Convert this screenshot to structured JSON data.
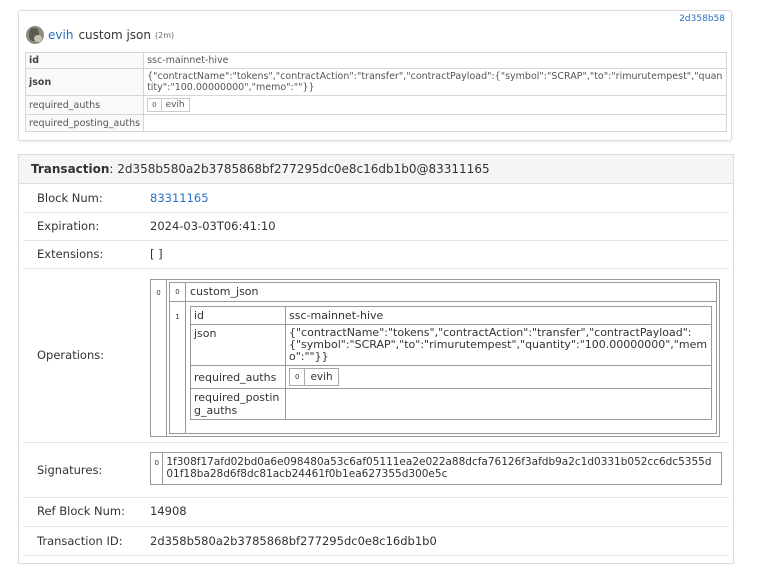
{
  "op_card": {
    "hash_link": "2d358b58",
    "user": "evih",
    "op_type": "custom json",
    "age": "(2m)",
    "fields": {
      "id_label": "id",
      "id_value": "ssc-mainnet-hive",
      "json_label": "json",
      "json_value": "{\"contractName\":\"tokens\",\"contractAction\":\"transfer\",\"contractPayload\":{\"symbol\":\"SCRAP\",\"to\":\"rimurutempest\",\"quantity\":\"100.00000000\",\"memo\":\"\"}}",
      "required_auths_label": "required_auths",
      "required_auths_index": "0",
      "required_auths_value": "evih",
      "required_posting_auths_label": "required_posting_auths"
    }
  },
  "transaction": {
    "header_label": "Transaction",
    "header_value": ": 2d358b580a2b3785868bf277295dc0e8c16db1b0@83311165",
    "block_num_label": "Block Num:",
    "block_num_value": "83311165",
    "expiration_label": "Expiration:",
    "expiration_value": "2024-03-03T06:41:10",
    "extensions_label": "Extensions:",
    "extensions_value": "[ ]",
    "operations_label": "Operations:",
    "operations": {
      "outer_index": "0",
      "inner_index": "0",
      "op_name": "custom_json",
      "param_index": "1",
      "id_label": "id",
      "id_value": "ssc-mainnet-hive",
      "json_label": "json",
      "json_value": "{\"contractName\":\"tokens\",\"contractAction\":\"transfer\",\"contractPayload\":{\"symbol\":\"SCRAP\",\"to\":\"rimurutempest\",\"quantity\":\"100.00000000\",\"memo\":\"\"}}",
      "required_auths_label": "required_auths",
      "required_auths_index": "0",
      "required_auths_value": "evih",
      "required_posting_auths_label": "required_posting_auths"
    },
    "signatures_label": "Signatures:",
    "signature_index": "0",
    "signature_value": "1f308f17afd02bd0a6e098480a53c6af05111ea2e022a88dcfa76126f3afdb9a2c1d0331b052cc6dc5355d01f18ba28d6f8dc81acb24461f0b1ea627355d300e5c",
    "ref_block_num_label": "Ref Block Num:",
    "ref_block_num_value": "14908",
    "transaction_id_label": "Transaction ID:",
    "transaction_id_value": "2d358b580a2b3785868bf277295dc0e8c16db1b0"
  },
  "colors": {
    "link": "#2a6fc2",
    "border": "#dcdcdc"
  }
}
